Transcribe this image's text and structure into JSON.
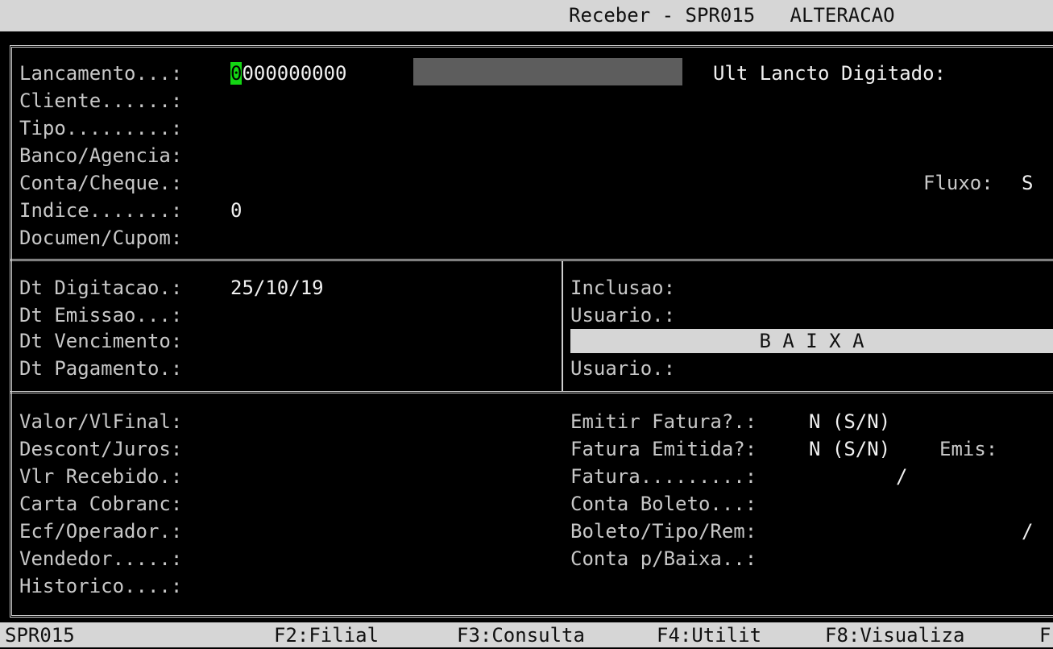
{
  "header": {
    "title": "Receber - SPR015",
    "mode": "ALTERACAO"
  },
  "section1": {
    "lancamento_label": "Lancamento...:",
    "lancamento_cursor": "0",
    "lancamento_rest": "000000000",
    "ult_lancto_label": "Ult Lancto Digitado:",
    "cliente_label": "Cliente......:",
    "tipo_label": "Tipo.........:",
    "banco_label": "Banco/Agencia:",
    "conta_label": "Conta/Cheque.:",
    "fluxo_label": "Fluxo:",
    "fluxo_value": "S",
    "indice_label": "Indice.......:",
    "indice_value": "0",
    "documen_label": "Documen/Cupom:"
  },
  "section2": {
    "dt_digitacao_label": "Dt Digitacao.:",
    "dt_digitacao_value": "25/10/19",
    "dt_emissao_label": "Dt Emissao...:",
    "dt_vencimento_label": "Dt Vencimento:",
    "dt_pagamento_label": "Dt Pagamento.:",
    "inclusao_label": "Inclusao:",
    "usuario1_label": "Usuario.:",
    "baixa_label": "B A I X A",
    "usuario2_label": "Usuario.:"
  },
  "section3": {
    "valor_label": "Valor/VlFinal:",
    "descont_label": "Descont/Juros:",
    "vlr_recebido_label": "Vlr Recebido.:",
    "carta_label": "Carta Cobranc:",
    "ecf_label": "Ecf/Operador.:",
    "vendedor_label": "Vendedor.....:",
    "historico_label": "Historico....:",
    "emitir_fatura_label": "Emitir Fatura?.:",
    "emitir_fatura_value": "N (S/N)",
    "fatura_emitida_label": "Fatura Emitida?:",
    "fatura_emitida_value": "N (S/N)",
    "emis_label": "Emis:",
    "fatura_label": "Fatura.........:",
    "fatura_slash": "/",
    "conta_boleto_label": "Conta Boleto...:",
    "boleto_tipo_label": "Boleto/Tipo/Rem:",
    "boleto_slash": "/",
    "conta_baixa_label": "Conta p/Baixa..:"
  },
  "footer": {
    "program": "SPR015",
    "f2": "F2:Filial",
    "f3": "F3:Consulta",
    "f4": "F4:Utilit",
    "f8": "F8:Visualiza",
    "more": "F"
  }
}
